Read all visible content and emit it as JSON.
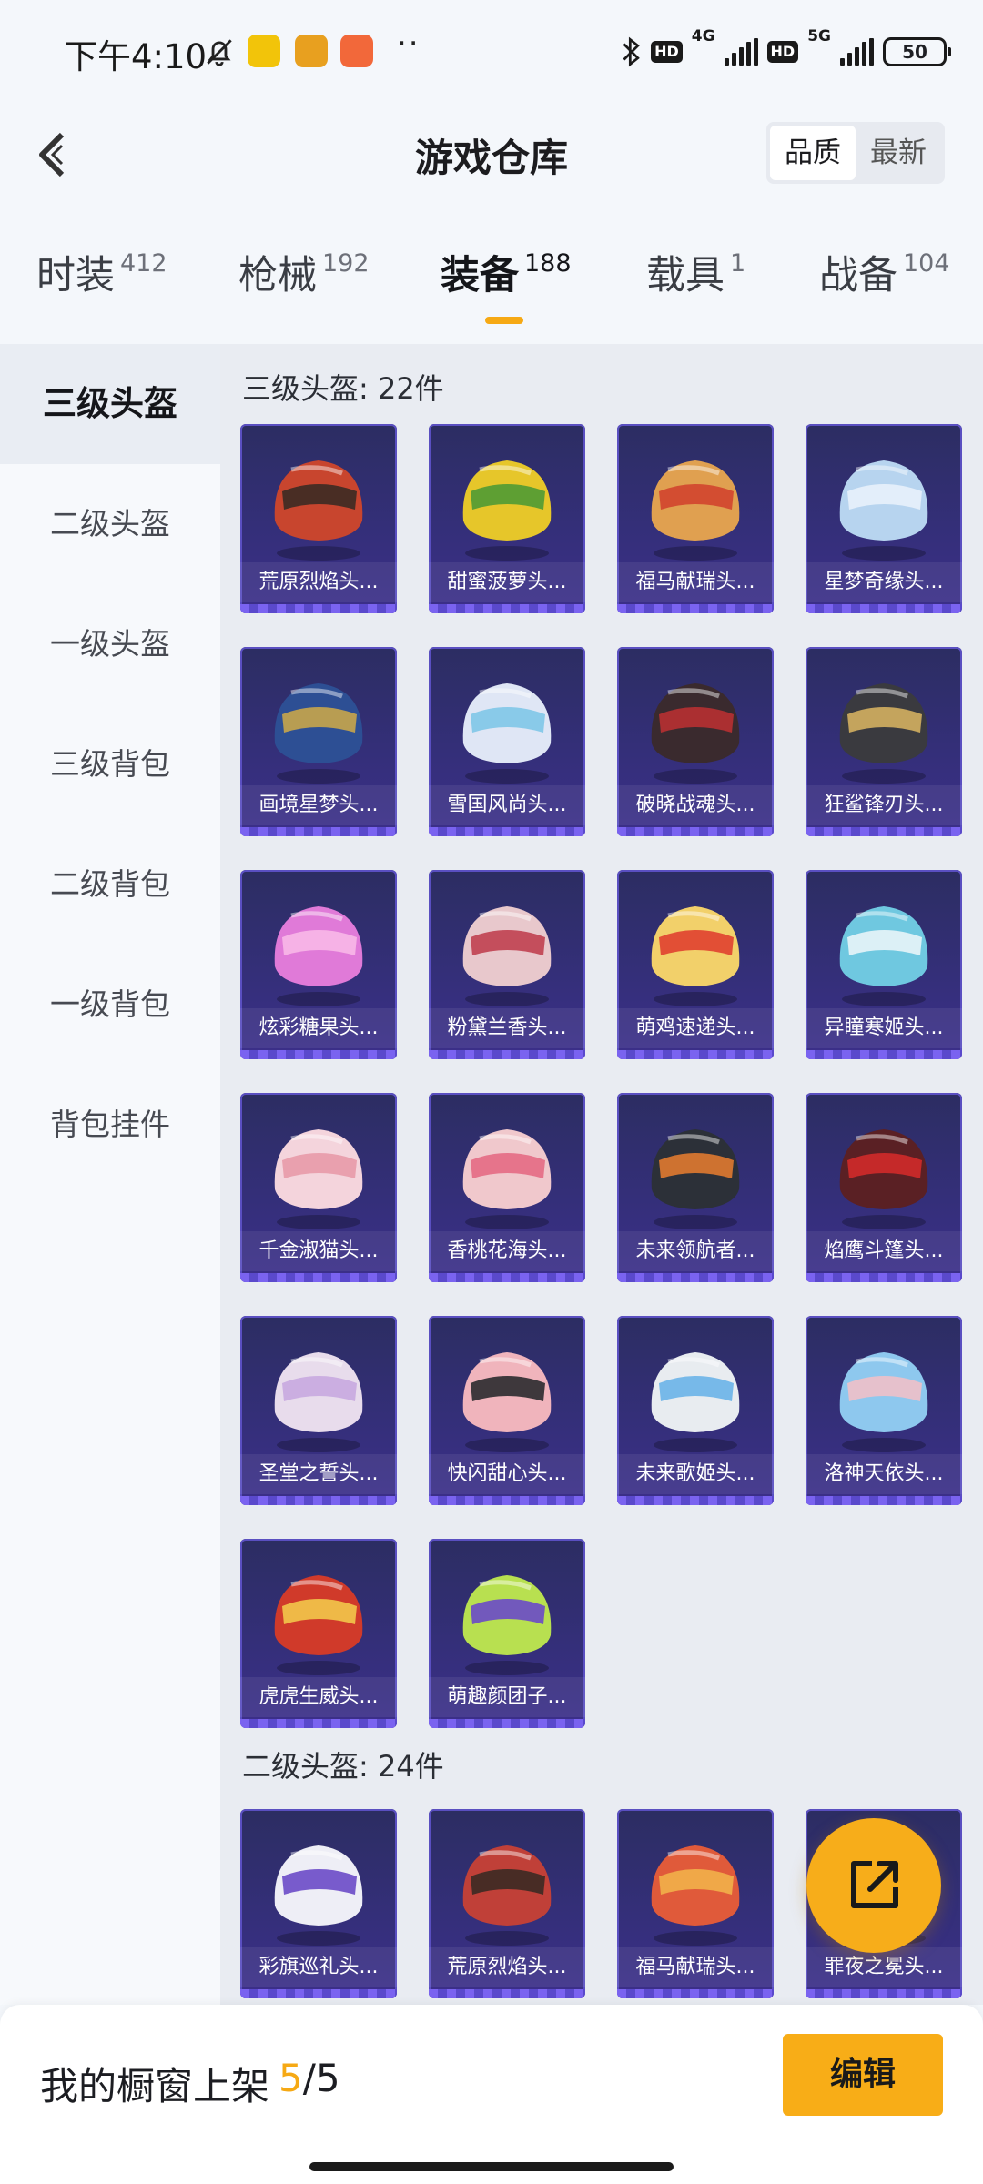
{
  "status_bar": {
    "time": "下午4:10",
    "network_1": "4G",
    "network_2": "5G",
    "hd": "HD",
    "battery": "50"
  },
  "header": {
    "title": "游戏仓库",
    "sort_options": [
      "品质",
      "最新"
    ],
    "active_sort": "品质"
  },
  "tabs": [
    {
      "label": "时装",
      "count": "412"
    },
    {
      "label": "枪械",
      "count": "192"
    },
    {
      "label": "装备",
      "count": "188"
    },
    {
      "label": "载具",
      "count": "1"
    },
    {
      "label": "战备",
      "count": "104"
    }
  ],
  "active_tab": "装备",
  "sidebar": {
    "items": [
      "三级头盔",
      "二级头盔",
      "一级头盔",
      "三级背包",
      "二级背包",
      "一级背包",
      "背包挂件"
    ],
    "active": "三级头盔"
  },
  "sections": [
    {
      "title": "三级头盔: 22件",
      "items": [
        {
          "name": "荒原烈焰头...",
          "color": "#c8452e",
          "accent": "#3b2a24"
        },
        {
          "name": "甜蜜菠萝头...",
          "color": "#e6c62a",
          "accent": "#4f9a34"
        },
        {
          "name": "福马献瑞头...",
          "color": "#e0a050",
          "accent": "#d2442e"
        },
        {
          "name": "星梦奇缘头...",
          "color": "#b7d4ef",
          "accent": "#e8f1fb"
        },
        {
          "name": "画境星梦头...",
          "color": "#2d4f94",
          "accent": "#c8a54a"
        },
        {
          "name": "雪国风尚头...",
          "color": "#dfe6f5",
          "accent": "#7fc6e8"
        },
        {
          "name": "破晓战魂头...",
          "color": "#3a2a2e",
          "accent": "#b83032"
        },
        {
          "name": "狂鲨锋刃头...",
          "color": "#3a3a3f",
          "accent": "#d4b060"
        },
        {
          "name": "炫彩糖果头...",
          "color": "#e07ad8",
          "accent": "#f8b8e8"
        },
        {
          "name": "粉黛兰香头...",
          "color": "#e8c8cc",
          "accent": "#c04050"
        },
        {
          "name": "萌鸡速递头...",
          "color": "#f2d06a",
          "accent": "#e04030"
        },
        {
          "name": "异瞳寒姬头...",
          "color": "#6fc8e0",
          "accent": "#e8f4f8"
        },
        {
          "name": "千金淑猫头...",
          "color": "#f4d4dc",
          "accent": "#e89aa8"
        },
        {
          "name": "香桃花海头...",
          "color": "#f0c8cc",
          "accent": "#e46a84"
        },
        {
          "name": "未来领航者...",
          "color": "#2c3038",
          "accent": "#e07a30"
        },
        {
          "name": "焰鹰斗篷头...",
          "color": "#5a2024",
          "accent": "#d02a2a"
        },
        {
          "name": "圣堂之誓头...",
          "color": "#e8dcec",
          "accent": "#c8a8e0"
        },
        {
          "name": "快闪甜心头...",
          "color": "#f0b4bc",
          "accent": "#2a2a2e"
        },
        {
          "name": "未来歌姬头...",
          "color": "#e8ecf0",
          "accent": "#6ab4e8"
        },
        {
          "name": "洛神天依头...",
          "color": "#8ec8ee",
          "accent": "#f0c0c8"
        },
        {
          "name": "虎虎生威头...",
          "color": "#d03a2a",
          "accent": "#f2c84a"
        },
        {
          "name": "萌趣颜团子...",
          "color": "#b8e050",
          "accent": "#6a4ac8"
        }
      ]
    },
    {
      "title": "二级头盔: 24件",
      "items": [
        {
          "name": "彩旗巡礼头...",
          "color": "#eeeef6",
          "accent": "#6a4ac8"
        },
        {
          "name": "荒原烈焰头...",
          "color": "#c04038",
          "accent": "#3b2a24"
        },
        {
          "name": "福马献瑞头...",
          "color": "#e05a3a",
          "accent": "#f2b04a"
        },
        {
          "name": "罪夜之冕头...",
          "color": "#3a2a4a",
          "accent": "#b890e0"
        }
      ]
    }
  ],
  "bottom_bar": {
    "label": "我的橱窗上架",
    "used": "5",
    "total": "/5",
    "edit": "编辑"
  },
  "colors": {
    "accent": "#f6a914",
    "card_bg": "#342f79",
    "page_bg": "#f4f7fb"
  },
  "icons": [
    "back-arrow-icon",
    "share-icon",
    "bell-mute-icon",
    "bluetooth-icon"
  ]
}
